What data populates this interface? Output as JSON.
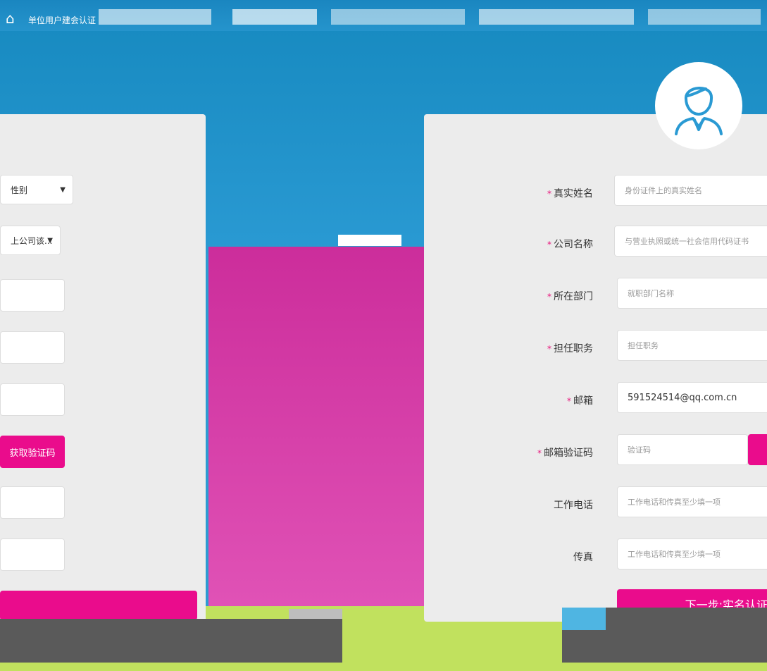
{
  "header": {
    "title": "单位用户建会认证"
  },
  "left_form": {
    "gender_select": "性别",
    "company_select": "上公司该...",
    "code_button": "获取验证码"
  },
  "right_form": {
    "fields": [
      {
        "label": "真实姓名",
        "required": true,
        "value": "",
        "placeholder": "身份证件上的真实姓名"
      },
      {
        "label": "公司名称",
        "required": true,
        "value": "",
        "placeholder": "与营业执照或统一社会信用代码证书"
      },
      {
        "label": "所在部门",
        "required": true,
        "value": "",
        "placeholder": "就职部门名称"
      },
      {
        "label": "担任职务",
        "required": true,
        "value": "",
        "placeholder": "担任职务"
      },
      {
        "label": "邮箱",
        "required": true,
        "value": "591524514@qq.com.cn",
        "placeholder": ""
      },
      {
        "label": "邮箱验证码",
        "required": true,
        "value": "",
        "placeholder": "验证码"
      },
      {
        "label": "工作电话",
        "required": false,
        "value": "",
        "placeholder": "工作电话和传真至少填一项"
      },
      {
        "label": "传真",
        "required": false,
        "value": "",
        "placeholder": "工作电话和传真至少填一项"
      }
    ],
    "next_button": "下一步:实名认证"
  },
  "colors": {
    "accent": "#ea0c8c",
    "header_bg": "#1689bf",
    "panel_bg": "#ececec"
  },
  "icons": {
    "avatar": "user-avatar-icon",
    "logo": "logo-icon"
  }
}
